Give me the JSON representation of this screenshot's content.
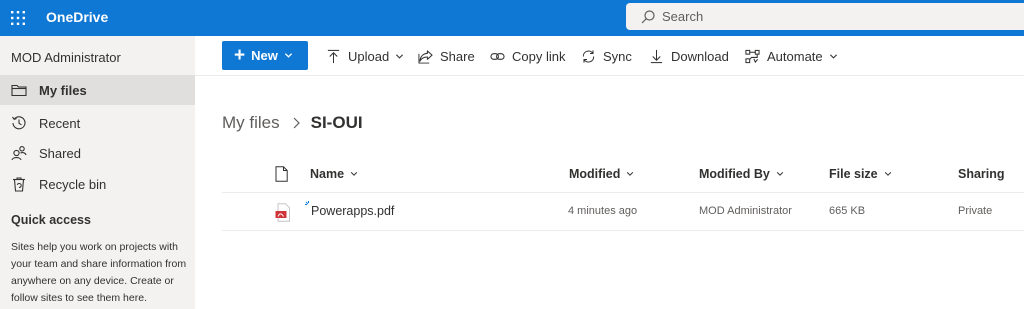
{
  "suite": {
    "app_title": "OneDrive",
    "search_placeholder": "Search",
    "accent_color": "#0f78d4"
  },
  "leftnav": {
    "user_name": "MOD Administrator",
    "items": [
      {
        "label": "My files",
        "icon": "folder-icon",
        "selected": true
      },
      {
        "label": "Recent",
        "icon": "history-icon",
        "selected": false
      },
      {
        "label": "Shared",
        "icon": "people-icon",
        "selected": false
      },
      {
        "label": "Recycle bin",
        "icon": "recycle-bin-icon",
        "selected": false
      }
    ],
    "quick_access_title": "Quick access",
    "quick_access_desc": "Sites help you work on projects with your team and share information from anywhere on any device. Create or follow sites to see them here."
  },
  "commandbar": {
    "new_label": "New",
    "upload_label": "Upload",
    "share_label": "Share",
    "copy_link_label": "Copy link",
    "sync_label": "Sync",
    "download_label": "Download",
    "automate_label": "Automate"
  },
  "breadcrumb": {
    "parent": "My files",
    "current": "SI-OUI"
  },
  "list": {
    "columns": {
      "name": "Name",
      "modified": "Modified",
      "modified_by": "Modified By",
      "file_size": "File size",
      "sharing": "Sharing"
    },
    "rows": [
      {
        "name": "Powerapps.pdf",
        "modified": "4 minutes ago",
        "modified_by": "MOD Administrator",
        "file_size": "665 KB",
        "sharing": "Private",
        "icon": "pdf-file-icon"
      }
    ]
  }
}
